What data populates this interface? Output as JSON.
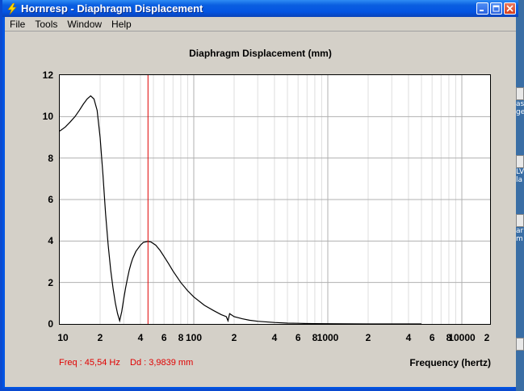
{
  "window": {
    "title": "Hornresp - Diaphragm Displacement"
  },
  "menu": {
    "items": [
      "File",
      "Tools",
      "Window",
      "Help"
    ]
  },
  "desktop_fragments": [
    "as",
    "ge",
    "LV",
    "la",
    "ar",
    "m"
  ],
  "readout": {
    "freq": "Freq : 45,54 Hz",
    "dd": "Dd : 3,9839 mm"
  },
  "colors": {
    "cursor": "#e00000",
    "curve": "#000000",
    "grid_major": "#b0b0b0",
    "grid_minor": "#dedede"
  },
  "chart_data": {
    "type": "line",
    "title": "Diaphragm Displacement (mm)",
    "xlabel": "Frequency (hertz)",
    "ylabel": "",
    "x_scale": "log",
    "xlim": [
      10,
      20000
    ],
    "ylim": [
      0,
      12
    ],
    "grid": true,
    "y_ticks": [
      "0",
      "2",
      "4",
      "6",
      "8",
      "10",
      "12"
    ],
    "x_ticks": [
      "10",
      "2",
      "4",
      "6",
      "8",
      "100",
      "2",
      "4",
      "6",
      "8",
      "1000",
      "2",
      "4",
      "6",
      "8",
      "10000",
      "2"
    ],
    "cursor_x": 45.54,
    "series": [
      {
        "x": [
          10,
          11,
          12,
          13,
          14,
          15,
          16,
          17,
          18,
          19,
          20,
          21,
          22,
          23,
          24,
          25,
          26,
          27,
          28,
          29,
          30,
          31,
          32,
          33,
          34,
          35,
          37,
          40,
          42,
          45.54,
          48,
          52,
          56,
          60,
          65,
          70,
          80,
          90,
          100,
          120,
          140,
          160,
          175,
          180,
          185,
          200,
          230,
          260,
          300,
          400,
          500,
          600,
          700,
          800,
          1000,
          2000,
          5000,
          20000
        ],
        "y": [
          9.3,
          9.5,
          9.75,
          10.0,
          10.3,
          10.6,
          10.85,
          11.0,
          10.85,
          10.3,
          9.0,
          7.2,
          5.3,
          3.8,
          2.6,
          1.7,
          1.0,
          0.5,
          0.15,
          0.6,
          1.2,
          1.75,
          2.2,
          2.6,
          2.9,
          3.15,
          3.5,
          3.8,
          3.93,
          3.98,
          3.95,
          3.8,
          3.55,
          3.25,
          2.9,
          2.55,
          2.0,
          1.6,
          1.3,
          0.9,
          0.65,
          0.45,
          0.35,
          0.15,
          0.5,
          0.35,
          0.25,
          0.18,
          0.13,
          0.07,
          0.04,
          0.03,
          0.02,
          0.015,
          0.01,
          0.0,
          0.0,
          0.0
        ]
      }
    ]
  }
}
